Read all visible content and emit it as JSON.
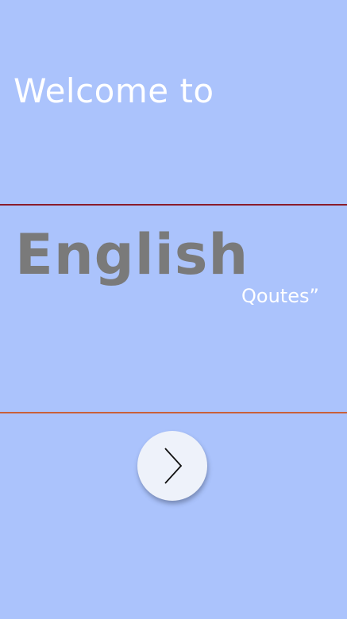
{
  "welcome": {
    "heading": "Welcome to"
  },
  "brand": {
    "title": "English",
    "subtitle": "Qoutes”"
  },
  "navigation": {
    "next_icon": "chevron-right-icon"
  },
  "colors": {
    "background": "#abc3fc",
    "heading_text": "#ffffff",
    "brand_text": "#7a7a7a",
    "divider_top": "#8a1c2a",
    "divider_bottom": "#c8603a",
    "button_fill": "#eef2fa"
  }
}
